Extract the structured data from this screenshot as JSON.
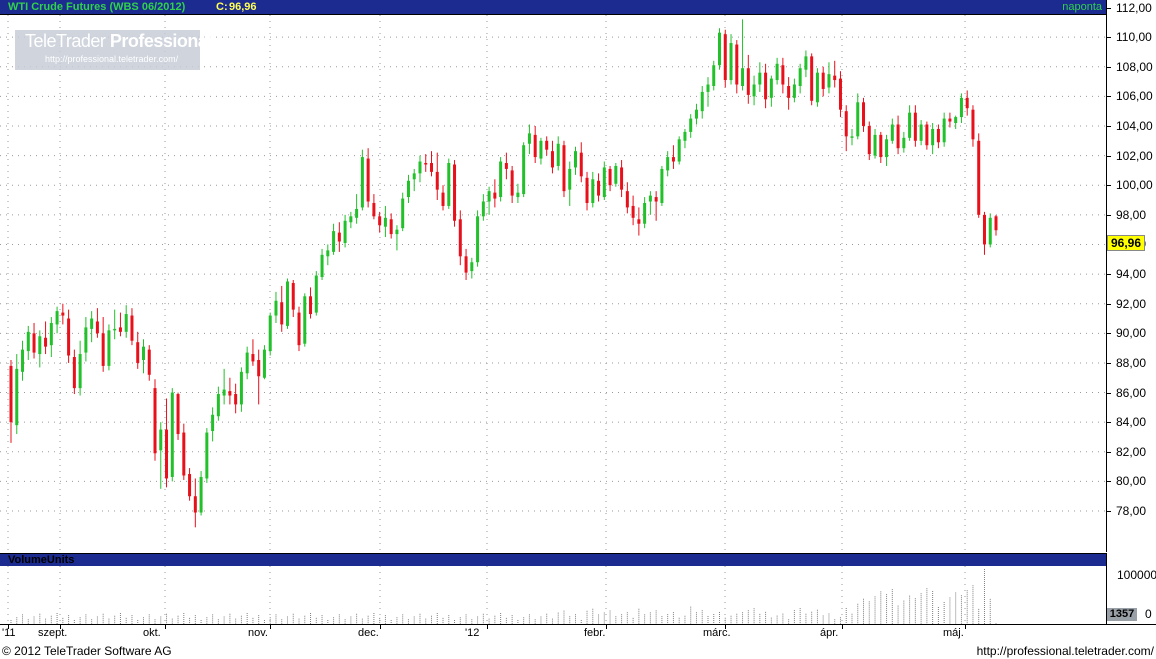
{
  "header": {
    "title": "WTI Crude Futures (WBS 06/2012)",
    "close_label": "C:",
    "close_value": "96,96",
    "period": "naponta"
  },
  "logo": {
    "name_regular": "TeleTrader",
    "name_bold": "Professional",
    "url": "http://professional.teletrader.com/"
  },
  "price_marker": "96,96",
  "volume_panel": {
    "title": "VolumeUnits",
    "tick_top": "100000",
    "tick_zero": "0",
    "marker": "1357"
  },
  "footer": {
    "copyright": "© 2012 TeleTrader Software AG",
    "url": "http://professional.teletrader.com/"
  },
  "colors": {
    "up": "#22c02a",
    "down": "#e8101a",
    "header_bg": "#1c2b8f",
    "header_title": "#2fd24a",
    "header_close": "#ffff55",
    "price_marker": "#ffff00",
    "grid": "#9a9a9a"
  },
  "chart_data": {
    "type": "candlestick",
    "title": "WTI Crude Futures (WBS 06/2012)",
    "xlabel": "",
    "ylabel": "",
    "ylim": [
      76.2,
      113
    ],
    "ytick_labels": [
      "78,00",
      "80,00",
      "82,00",
      "84,00",
      "86,00",
      "88,00",
      "90,00",
      "92,00",
      "94,00",
      "96,00",
      "98,00",
      "100,00",
      "102,00",
      "104,00",
      "106,00",
      "108,00",
      "110,00",
      "112,00"
    ],
    "date_labels": [
      "'11",
      "szept.",
      "okt.",
      "nov.",
      "dec.",
      "'12",
      "febr.",
      "márc.",
      "ápr.",
      "máj."
    ],
    "last_close": 96.96,
    "volume_range": [
      0,
      100000
    ],
    "volume_last": 1357,
    "ohlc": [
      [
        87.8,
        88.2,
        82.6,
        84.0
      ],
      [
        83.8,
        88.6,
        83.2,
        87.6
      ],
      [
        87.4,
        89.5,
        86.8,
        88.9
      ],
      [
        88.8,
        90.5,
        88.2,
        90.1
      ],
      [
        90.0,
        90.7,
        88.3,
        88.7
      ],
      [
        88.6,
        90.2,
        87.7,
        89.8
      ],
      [
        89.7,
        90.8,
        88.6,
        89.1
      ],
      [
        89.2,
        91.1,
        88.4,
        90.7
      ],
      [
        90.6,
        91.8,
        90.0,
        91.5
      ],
      [
        91.4,
        92.0,
        90.6,
        91.2
      ],
      [
        91.0,
        91.6,
        88.0,
        88.5
      ],
      [
        88.4,
        88.9,
        85.9,
        86.3
      ],
      [
        86.3,
        89.5,
        85.8,
        88.6
      ],
      [
        88.7,
        91.1,
        88.1,
        90.4
      ],
      [
        90.3,
        91.5,
        89.4,
        91.0
      ],
      [
        90.8,
        91.7,
        89.7,
        90.0
      ],
      [
        90.0,
        91.1,
        87.4,
        87.8
      ],
      [
        87.8,
        90.6,
        87.5,
        90.2
      ],
      [
        90.2,
        91.6,
        89.6,
        90.3
      ],
      [
        90.4,
        91.4,
        89.8,
        90.1
      ],
      [
        90.1,
        91.9,
        89.7,
        91.3
      ],
      [
        91.2,
        91.7,
        89.2,
        89.5
      ],
      [
        89.4,
        90.1,
        87.6,
        88.0
      ],
      [
        88.2,
        89.6,
        87.3,
        89.1
      ],
      [
        88.9,
        89.2,
        86.8,
        87.2
      ],
      [
        86.3,
        86.9,
        81.4,
        81.9
      ],
      [
        82.1,
        84.0,
        79.5,
        83.5
      ],
      [
        83.5,
        85.6,
        79.6,
        80.2
      ],
      [
        80.3,
        86.3,
        80.0,
        86.0
      ],
      [
        85.9,
        86.0,
        82.8,
        83.2
      ],
      [
        83.3,
        83.9,
        80.1,
        80.4
      ],
      [
        80.5,
        80.9,
        78.7,
        79.0
      ],
      [
        79.0,
        80.2,
        76.9,
        77.9
      ],
      [
        77.9,
        80.7,
        77.7,
        80.3
      ],
      [
        80.2,
        83.6,
        79.9,
        83.3
      ],
      [
        83.4,
        85.0,
        82.7,
        84.5
      ],
      [
        84.4,
        86.4,
        84.1,
        85.9
      ],
      [
        85.8,
        87.6,
        85.2,
        86.2
      ],
      [
        86.1,
        87.0,
        85.2,
        85.8
      ],
      [
        85.9,
        86.6,
        84.6,
        85.2
      ],
      [
        85.2,
        87.7,
        84.7,
        87.4
      ],
      [
        87.3,
        89.1,
        86.9,
        88.7
      ],
      [
        88.6,
        89.6,
        87.8,
        88.1
      ],
      [
        88.2,
        88.9,
        85.2,
        87.1
      ],
      [
        87.0,
        89.2,
        86.9,
        88.9
      ],
      [
        88.8,
        91.4,
        88.5,
        91.2
      ],
      [
        91.2,
        92.8,
        90.7,
        92.2
      ],
      [
        92.1,
        93.2,
        90.1,
        90.6
      ],
      [
        90.5,
        93.7,
        90.3,
        93.5
      ],
      [
        93.4,
        93.6,
        91.1,
        91.6
      ],
      [
        91.4,
        91.8,
        88.8,
        89.2
      ],
      [
        89.3,
        92.7,
        89.1,
        92.5
      ],
      [
        92.5,
        93.1,
        91.0,
        91.3
      ],
      [
        91.4,
        94.2,
        91.2,
        93.9
      ],
      [
        93.8,
        95.7,
        93.6,
        95.3
      ],
      [
        95.2,
        96.0,
        94.6,
        95.6
      ],
      [
        95.5,
        97.4,
        95.3,
        96.9
      ],
      [
        96.8,
        97.5,
        95.5,
        96.2
      ],
      [
        96.1,
        98.0,
        95.8,
        97.6
      ],
      [
        97.5,
        98.2,
        97.1,
        97.9
      ],
      [
        97.8,
        99.4,
        97.4,
        98.4
      ],
      [
        98.5,
        102.4,
        98.3,
        101.9
      ],
      [
        101.8,
        102.5,
        98.5,
        98.9
      ],
      [
        98.8,
        99.4,
        97.7,
        97.9
      ],
      [
        97.9,
        98.2,
        96.8,
        97.3
      ],
      [
        97.2,
        98.6,
        96.5,
        97.8
      ],
      [
        97.7,
        98.1,
        96.4,
        96.7
      ],
      [
        96.7,
        97.3,
        95.6,
        97.0
      ],
      [
        97.1,
        99.5,
        96.9,
        99.1
      ],
      [
        99.2,
        100.7,
        98.8,
        100.3
      ],
      [
        100.4,
        101.1,
        99.6,
        100.8
      ],
      [
        100.8,
        102.0,
        100.2,
        101.6
      ],
      [
        101.5,
        102.1,
        100.9,
        101.4
      ],
      [
        101.5,
        102.3,
        100.6,
        100.9
      ],
      [
        100.9,
        102.2,
        99.0,
        99.7
      ],
      [
        99.5,
        100.0,
        98.3,
        98.6
      ],
      [
        98.6,
        101.8,
        98.4,
        101.5
      ],
      [
        101.4,
        101.7,
        97.2,
        97.6
      ],
      [
        97.7,
        98.3,
        94.6,
        95.2
      ],
      [
        95.2,
        95.7,
        93.6,
        94.1
      ],
      [
        94.2,
        95.1,
        93.7,
        94.8
      ],
      [
        94.8,
        98.3,
        94.5,
        97.9
      ],
      [
        97.9,
        99.4,
        97.6,
        98.9
      ],
      [
        98.9,
        99.9,
        98.0,
        99.6
      ],
      [
        99.5,
        100.4,
        98.5,
        99.1
      ],
      [
        99.2,
        101.9,
        98.9,
        101.6
      ],
      [
        101.5,
        102.2,
        100.4,
        101.1
      ],
      [
        101.0,
        101.3,
        98.8,
        99.3
      ],
      [
        99.2,
        100.1,
        98.8,
        99.5
      ],
      [
        99.4,
        102.9,
        99.2,
        102.7
      ],
      [
        102.8,
        104.1,
        102.1,
        103.5
      ],
      [
        103.4,
        104.0,
        101.5,
        101.9
      ],
      [
        101.8,
        103.2,
        101.4,
        103.0
      ],
      [
        103.0,
        103.3,
        102.0,
        102.4
      ],
      [
        102.3,
        103.0,
        100.8,
        101.2
      ],
      [
        101.3,
        103.3,
        101.0,
        102.8
      ],
      [
        102.7,
        103.0,
        99.2,
        99.6
      ],
      [
        99.7,
        101.6,
        98.6,
        101.1
      ],
      [
        101.2,
        102.6,
        100.7,
        102.3
      ],
      [
        102.2,
        102.9,
        100.2,
        100.6
      ],
      [
        100.5,
        100.9,
        98.3,
        98.8
      ],
      [
        98.8,
        100.9,
        98.5,
        100.4
      ],
      [
        100.3,
        100.8,
        98.9,
        99.3
      ],
      [
        99.2,
        101.6,
        99.0,
        101.2
      ],
      [
        101.1,
        101.3,
        99.6,
        100.0
      ],
      [
        100.1,
        101.5,
        99.9,
        101.3
      ],
      [
        101.2,
        101.7,
        99.2,
        99.7
      ],
      [
        99.6,
        100.2,
        98.1,
        98.5
      ],
      [
        98.6,
        99.3,
        97.3,
        97.8
      ],
      [
        97.7,
        98.5,
        96.6,
        97.4
      ],
      [
        97.4,
        99.2,
        97.1,
        98.8
      ],
      [
        98.9,
        99.6,
        98.0,
        99.3
      ],
      [
        99.2,
        99.6,
        97.6,
        98.9
      ],
      [
        98.8,
        101.3,
        98.6,
        101.1
      ],
      [
        101.0,
        102.3,
        100.6,
        101.9
      ],
      [
        101.9,
        102.7,
        101.1,
        101.6
      ],
      [
        101.6,
        103.3,
        101.4,
        103.1
      ],
      [
        103.0,
        103.8,
        102.5,
        103.6
      ],
      [
        103.6,
        104.8,
        103.2,
        104.5
      ],
      [
        104.5,
        105.5,
        104.1,
        105.1
      ],
      [
        105.0,
        106.7,
        104.5,
        106.3
      ],
      [
        106.3,
        107.3,
        105.3,
        106.8
      ],
      [
        106.7,
        108.4,
        106.4,
        108.1
      ],
      [
        108.1,
        110.6,
        107.8,
        110.3
      ],
      [
        110.2,
        110.5,
        106.6,
        107.1
      ],
      [
        107.1,
        110.2,
        106.8,
        109.6
      ],
      [
        109.5,
        109.8,
        106.2,
        106.8
      ],
      [
        106.7,
        111.2,
        106.4,
        107.9
      ],
      [
        107.9,
        108.8,
        105.5,
        106.1
      ],
      [
        106.0,
        107.4,
        105.4,
        106.8
      ],
      [
        106.8,
        108.3,
        106.3,
        107.6
      ],
      [
        107.6,
        108.2,
        105.2,
        105.8
      ],
      [
        105.9,
        107.4,
        105.3,
        107.2
      ],
      [
        107.1,
        108.6,
        106.8,
        108.2
      ],
      [
        108.1,
        108.6,
        106.2,
        106.8
      ],
      [
        106.7,
        107.3,
        105.1,
        105.9
      ],
      [
        105.9,
        107.2,
        105.6,
        106.8
      ],
      [
        106.7,
        108.2,
        106.2,
        107.9
      ],
      [
        107.8,
        109.1,
        107.3,
        108.7
      ],
      [
        108.7,
        108.9,
        105.4,
        105.7
      ],
      [
        105.6,
        107.9,
        105.3,
        107.6
      ],
      [
        107.6,
        108.0,
        106.0,
        106.5
      ],
      [
        106.6,
        108.3,
        106.2,
        107.5
      ],
      [
        107.4,
        108.4,
        106.6,
        107.1
      ],
      [
        107.2,
        107.7,
        104.6,
        105.1
      ],
      [
        105.0,
        105.4,
        102.3,
        103.3
      ],
      [
        103.2,
        103.8,
        102.7,
        103.3
      ],
      [
        103.3,
        106.2,
        103.1,
        105.6
      ],
      [
        105.6,
        105.9,
        103.6,
        104.0
      ],
      [
        104.0,
        104.3,
        101.7,
        102.1
      ],
      [
        102.0,
        103.8,
        101.8,
        103.4
      ],
      [
        103.4,
        103.6,
        101.5,
        101.9
      ],
      [
        101.9,
        103.4,
        101.3,
        103.1
      ],
      [
        103.0,
        104.5,
        102.8,
        104.1
      ],
      [
        104.1,
        104.7,
        102.1,
        102.5
      ],
      [
        102.5,
        103.6,
        102.2,
        103.2
      ],
      [
        103.2,
        105.4,
        103.0,
        104.9
      ],
      [
        104.9,
        105.4,
        102.6,
        103.0
      ],
      [
        103.0,
        104.4,
        102.7,
        104.1
      ],
      [
        104.1,
        104.3,
        102.4,
        102.7
      ],
      [
        102.7,
        104.2,
        102.1,
        103.8
      ],
      [
        103.8,
        104.1,
        102.5,
        102.9
      ],
      [
        102.9,
        104.9,
        102.6,
        104.5
      ],
      [
        104.5,
        104.9,
        103.9,
        104.3
      ],
      [
        104.2,
        104.7,
        103.8,
        104.6
      ],
      [
        104.6,
        106.2,
        104.2,
        105.9
      ],
      [
        105.9,
        106.4,
        104.7,
        105.2
      ],
      [
        105.1,
        105.4,
        102.6,
        103.1
      ],
      [
        103.0,
        103.5,
        97.8,
        98.0
      ],
      [
        98.0,
        98.2,
        95.3,
        96.0
      ],
      [
        96.0,
        98.1,
        95.8,
        97.8
      ],
      [
        97.9,
        98.0,
        96.6,
        96.96
      ]
    ]
  }
}
